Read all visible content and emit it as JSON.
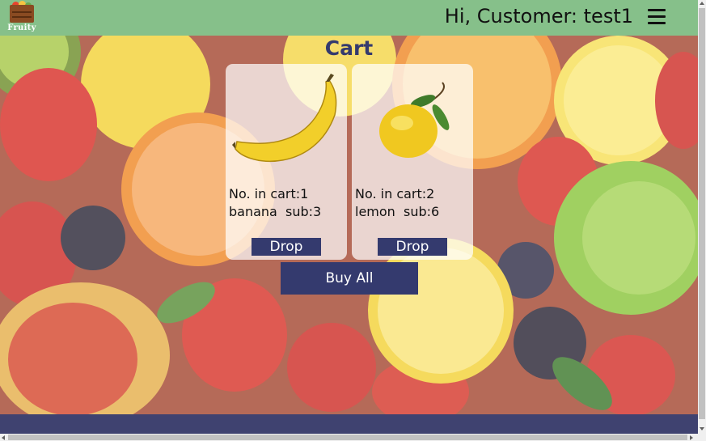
{
  "header": {
    "logo_text": "Fruity",
    "greeting": "Hi, Customer: test1",
    "menu_icon": "hamburger-icon",
    "background_color": "#86c08a"
  },
  "cart": {
    "title": "Cart",
    "items": [
      {
        "image_icon": "banana-icon",
        "count_text": "No. in cart:1",
        "detail_text": "banana  sub:3",
        "drop_label": "Drop"
      },
      {
        "image_icon": "lemon-icon",
        "count_text": "No. in cart:2",
        "detail_text": "lemon  sub:6",
        "drop_label": "Drop"
      }
    ],
    "buy_all_label": "Buy All"
  },
  "colors": {
    "accent": "#343a6e",
    "footer": "#3f4270"
  }
}
